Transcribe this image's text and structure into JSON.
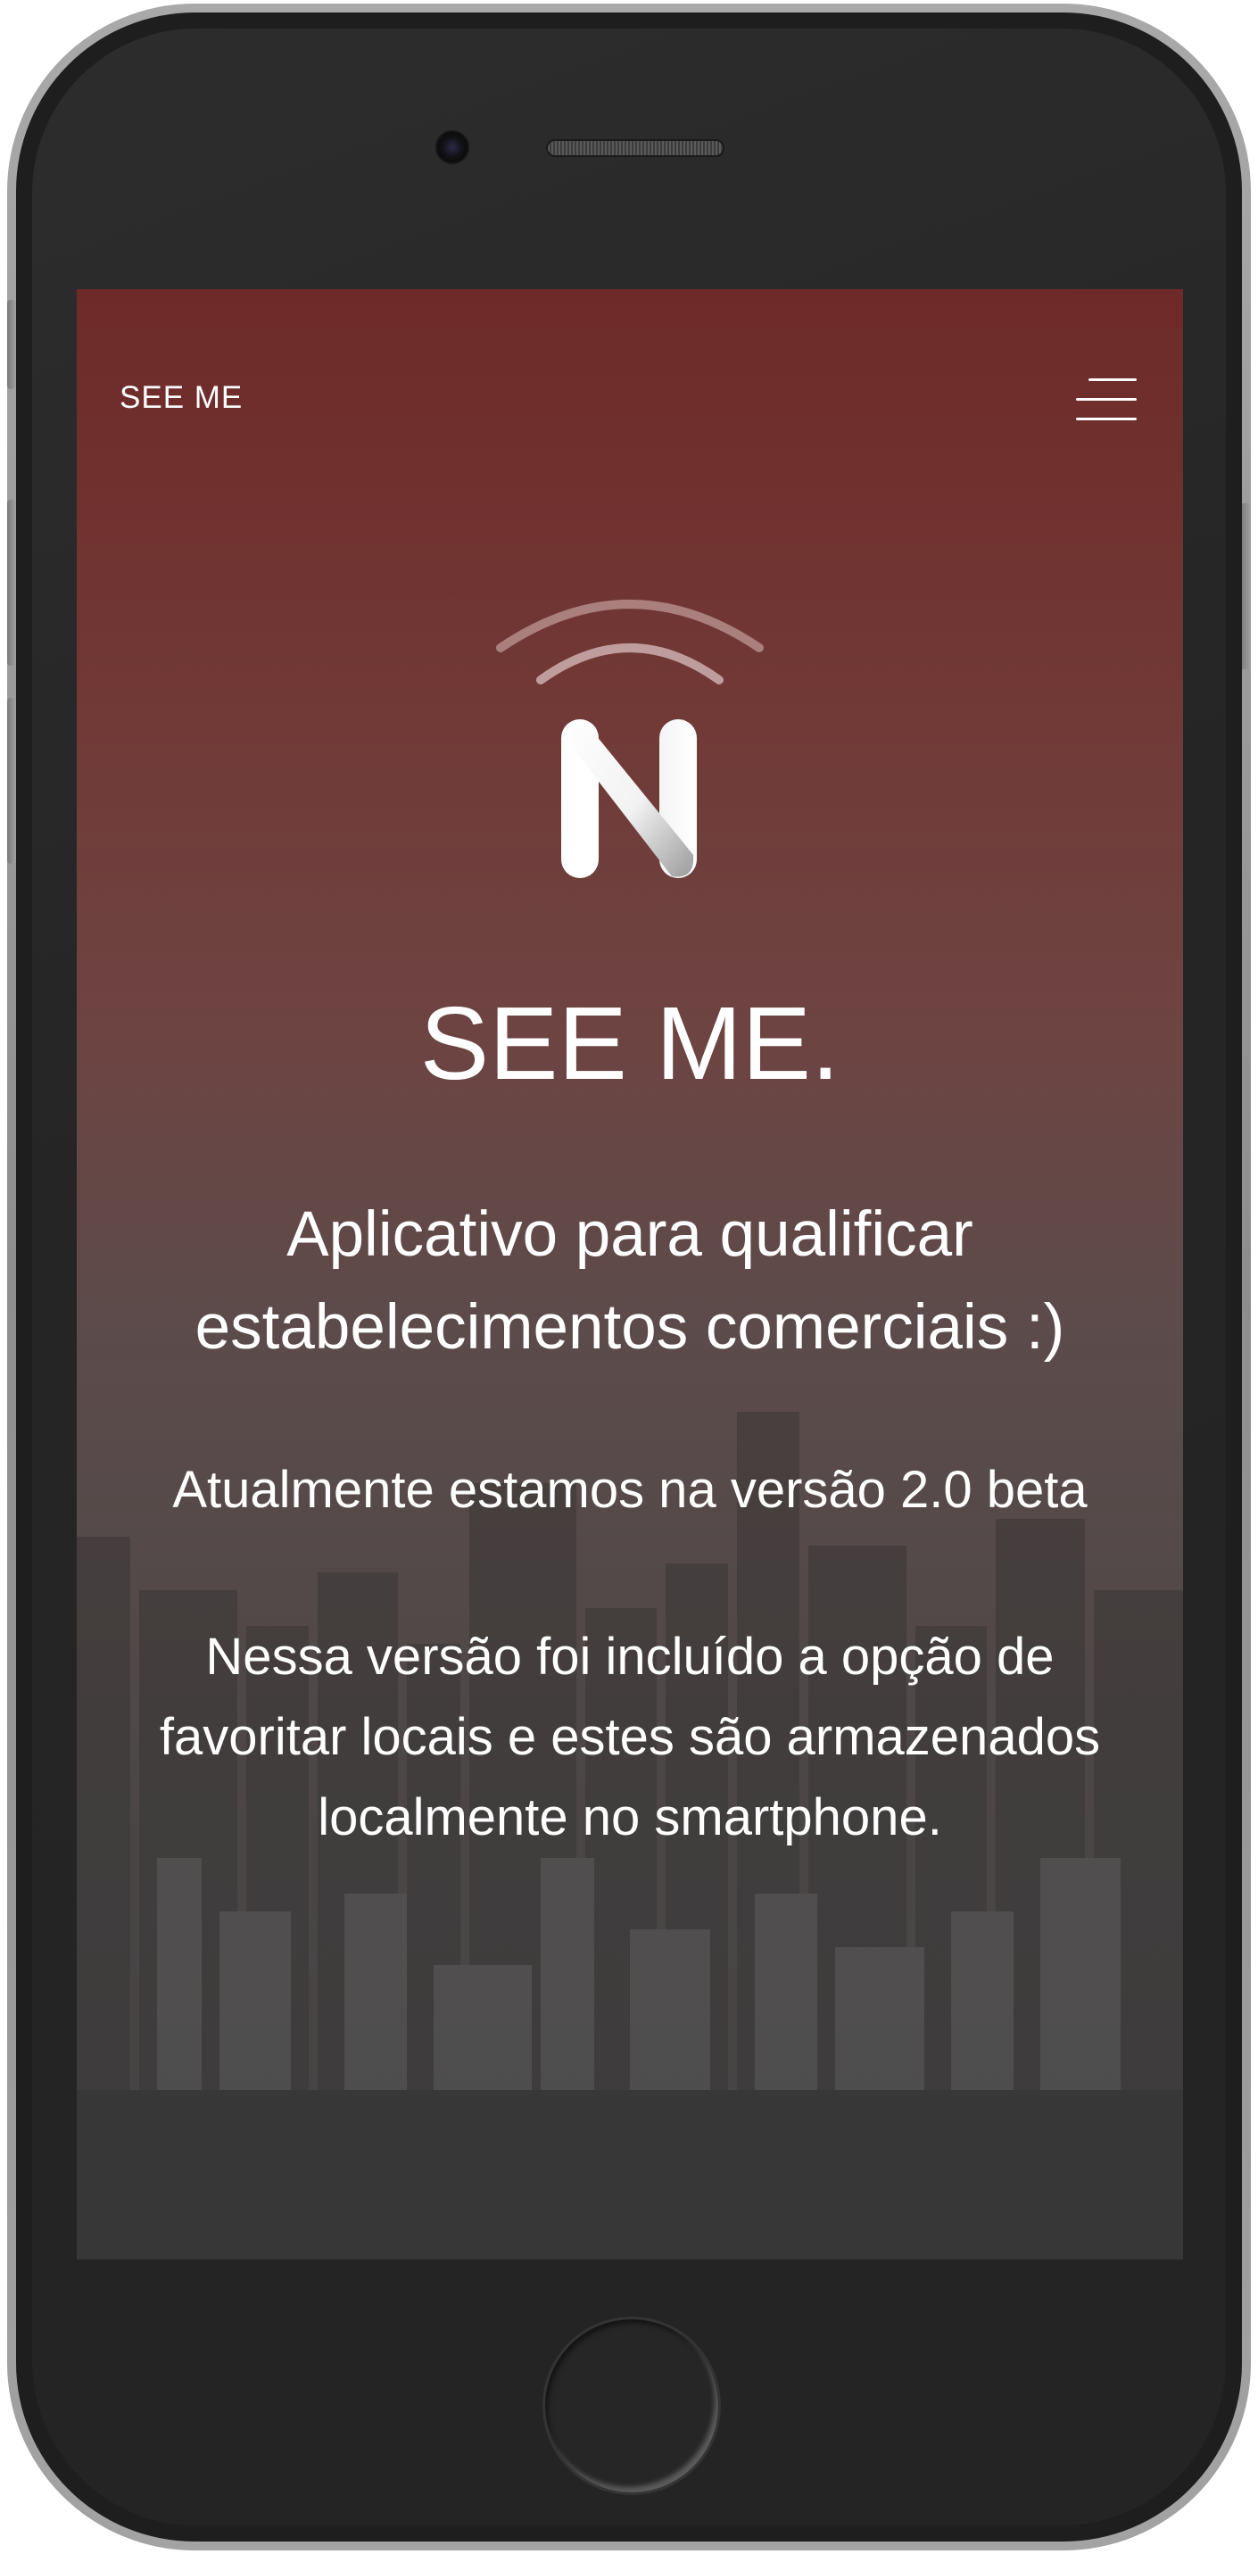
{
  "navbar": {
    "brand": "SEE ME",
    "menu_icon": "hamburger-menu-icon"
  },
  "hero": {
    "logo_icon": "signal-n-logo-icon",
    "title": "SEE ME.",
    "subtitle_line1": "Aplicativo para qualificar",
    "subtitle_line2": "estabelecimentos comerciais :)",
    "version": "Atualmente estamos na versão 2.0 beta",
    "description_line1": "Nessa versão foi incluído a opção de",
    "description_line2": "favoritar locais e estes são armazenados",
    "description_line3": "localmente no smartphone."
  },
  "background": {
    "image": "city-skyline",
    "gradient_top": "#6e2a28",
    "gradient_bottom": "#454545"
  },
  "device": {
    "frame_color": "#1e1e1e",
    "bezel_color": "#a9a9a9"
  }
}
